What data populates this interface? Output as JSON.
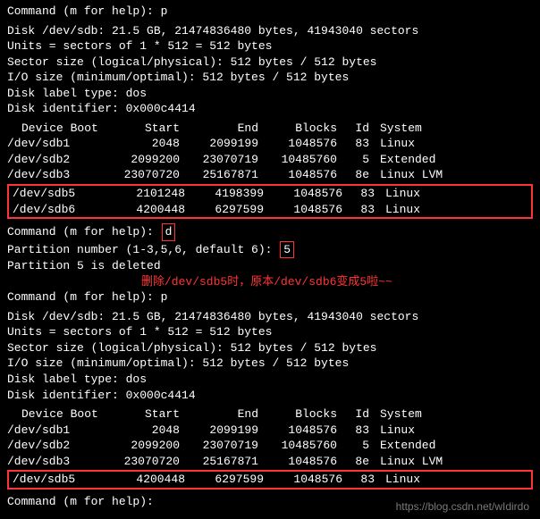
{
  "prompt1": "Command (m for help): p",
  "blank": " ",
  "disk1": {
    "l1": "Disk /dev/sdb: 21.5 GB, 21474836480 bytes, 41943040 sectors",
    "l2": "Units = sectors of 1 * 512 = 512 bytes",
    "l3": "Sector size (logical/physical): 512 bytes / 512 bytes",
    "l4": "I/O size (minimum/optimal): 512 bytes / 512 bytes",
    "l5": "Disk label type: dos",
    "l6": "Disk identifier: 0x000c4414"
  },
  "hdr": {
    "dev": "Device Boot",
    "start": "Start",
    "end": "End",
    "blocks": "Blocks",
    "id": "Id",
    "sys": "System"
  },
  "t1": [
    {
      "dev": "/dev/sdb1",
      "start": "2048",
      "end": "2099199",
      "blocks": "1048576",
      "id": "83",
      "sys": "Linux"
    },
    {
      "dev": "/dev/sdb2",
      "start": "2099200",
      "end": "23070719",
      "blocks": "10485760",
      "id": "5",
      "sys": "Extended"
    },
    {
      "dev": "/dev/sdb3",
      "start": "23070720",
      "end": "25167871",
      "blocks": "1048576",
      "id": "8e",
      "sys": "Linux LVM"
    },
    {
      "dev": "/dev/sdb5",
      "start": "2101248",
      "end": "4198399",
      "blocks": "1048576",
      "id": "83",
      "sys": "Linux"
    },
    {
      "dev": "/dev/sdb6",
      "start": "4200448",
      "end": "6297599",
      "blocks": "1048576",
      "id": "83",
      "sys": "Linux"
    }
  ],
  "prompt2_pre": "Command (m for help): ",
  "prompt2_cmd": "d",
  "pnum_pre": "Partition number (1-3,5,6, default 6): ",
  "pnum_val": "5",
  "deleted": "Partition 5 is deleted",
  "annotation": "删除/dev/sdb5时，原本/dev/sdb6变成5啦~~",
  "prompt3": "Command (m for help): p",
  "disk2": {
    "l1": "Disk /dev/sdb: 21.5 GB, 21474836480 bytes, 41943040 sectors",
    "l2": "Units = sectors of 1 * 512 = 512 bytes",
    "l3": "Sector size (logical/physical): 512 bytes / 512 bytes",
    "l4": "I/O size (minimum/optimal): 512 bytes / 512 bytes",
    "l5": "Disk label type: dos",
    "l6": "Disk identifier: 0x000c4414"
  },
  "t2": [
    {
      "dev": "/dev/sdb1",
      "start": "2048",
      "end": "2099199",
      "blocks": "1048576",
      "id": "83",
      "sys": "Linux"
    },
    {
      "dev": "/dev/sdb2",
      "start": "2099200",
      "end": "23070719",
      "blocks": "10485760",
      "id": "5",
      "sys": "Extended"
    },
    {
      "dev": "/dev/sdb3",
      "start": "23070720",
      "end": "25167871",
      "blocks": "1048576",
      "id": "8e",
      "sys": "Linux LVM"
    },
    {
      "dev": "/dev/sdb5",
      "start": "4200448",
      "end": "6297599",
      "blocks": "1048576",
      "id": "83",
      "sys": "Linux"
    }
  ],
  "prompt4": "Command (m for help): ",
  "watermark": "https://blog.csdn.net/wIdirdo"
}
